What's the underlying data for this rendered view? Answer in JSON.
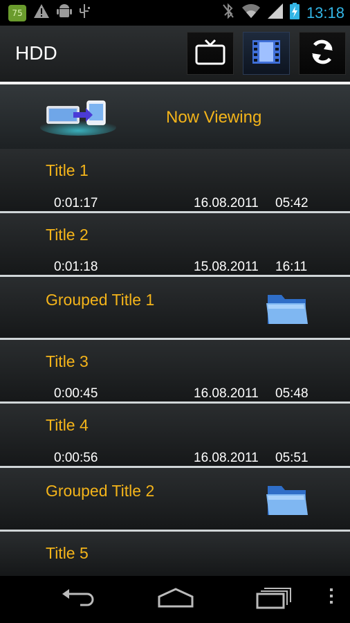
{
  "status_bar": {
    "notification_badge": "75",
    "time": "13:18",
    "icons": [
      "warning-icon",
      "android-icon",
      "usb-icon",
      "bluetooth-off-icon",
      "wifi-icon",
      "signal-icon",
      "battery-charging-icon"
    ]
  },
  "action_bar": {
    "title": "HDD",
    "buttons": [
      "tv-icon",
      "film-icon",
      "refresh-icon"
    ],
    "accent_color": "#33b5e5"
  },
  "now_viewing": {
    "label": "Now Viewing"
  },
  "items": [
    {
      "title": "Title 1",
      "duration": "0:01:17",
      "date": "16.08.2011",
      "time": "05:42"
    },
    {
      "title": "Title 2",
      "duration": "0:01:18",
      "date": "15.08.2011",
      "time": "16:11"
    },
    {
      "title": "Grouped Title 1",
      "folder": true
    },
    {
      "title": "Title 3",
      "duration": "0:00:45",
      "date": "16.08.2011",
      "time": "05:48"
    },
    {
      "title": "Title 4",
      "duration": "0:00:56",
      "date": "16.08.2011",
      "time": "05:51"
    },
    {
      "title": "Grouped Title 2",
      "folder": true
    },
    {
      "title": "Title 5"
    }
  ],
  "colors": {
    "title_text": "#f4b41a",
    "separator": "#d0d6d8"
  }
}
